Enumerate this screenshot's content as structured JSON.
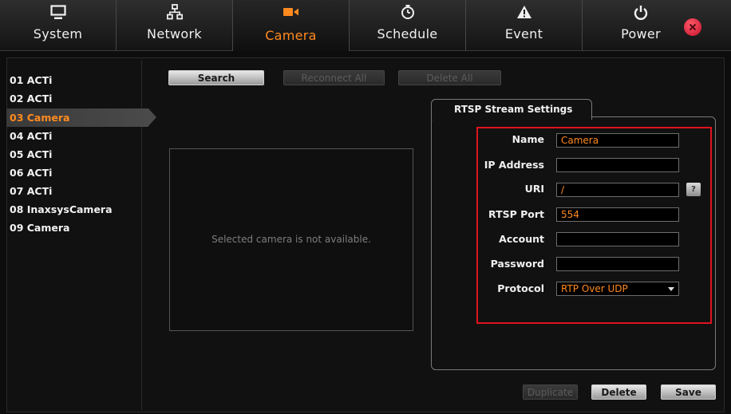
{
  "nav": {
    "tabs": [
      {
        "label": "System",
        "icon": "monitor-icon"
      },
      {
        "label": "Network",
        "icon": "network-icon"
      },
      {
        "label": "Camera",
        "icon": "camera-icon",
        "active": true
      },
      {
        "label": "Schedule",
        "icon": "clock-icon"
      },
      {
        "label": "Event",
        "icon": "warning-icon"
      },
      {
        "label": "Power",
        "icon": "power-icon"
      }
    ],
    "close_icon": "close-icon",
    "accent_color": "#ff8a1f",
    "close_color": "#d9142e"
  },
  "cameras": [
    {
      "label": "01 ACTi"
    },
    {
      "label": "02 ACTi"
    },
    {
      "label": "03 Camera",
      "selected": true
    },
    {
      "label": "04 ACTi"
    },
    {
      "label": "05 ACTi"
    },
    {
      "label": "06 ACTi"
    },
    {
      "label": "07 ACTi"
    },
    {
      "label": "08 InaxsysCamera"
    },
    {
      "label": "09 Camera"
    }
  ],
  "toolbar": {
    "search_label": "Search",
    "reconnect_all_label": "Reconnect All",
    "delete_all_label": "Delete All"
  },
  "preview": {
    "message": "Selected camera is not available."
  },
  "rtsp": {
    "tab_label": "RTSP Stream Settings",
    "fields": {
      "name": {
        "label": "Name",
        "value": "Camera"
      },
      "ip": {
        "label": "IP Address",
        "value": ""
      },
      "uri": {
        "label": "URI",
        "value": "/"
      },
      "port": {
        "label": "RTSP Port",
        "value": "554"
      },
      "account": {
        "label": "Account",
        "value": ""
      },
      "password": {
        "label": "Password",
        "value": ""
      },
      "protocol": {
        "label": "Protocol",
        "value": "RTP Over UDP"
      }
    },
    "help_label": "?",
    "highlight_color": "#e0131f"
  },
  "footer": {
    "duplicate_label": "Duplicate",
    "delete_label": "Delete",
    "save_label": "Save"
  }
}
